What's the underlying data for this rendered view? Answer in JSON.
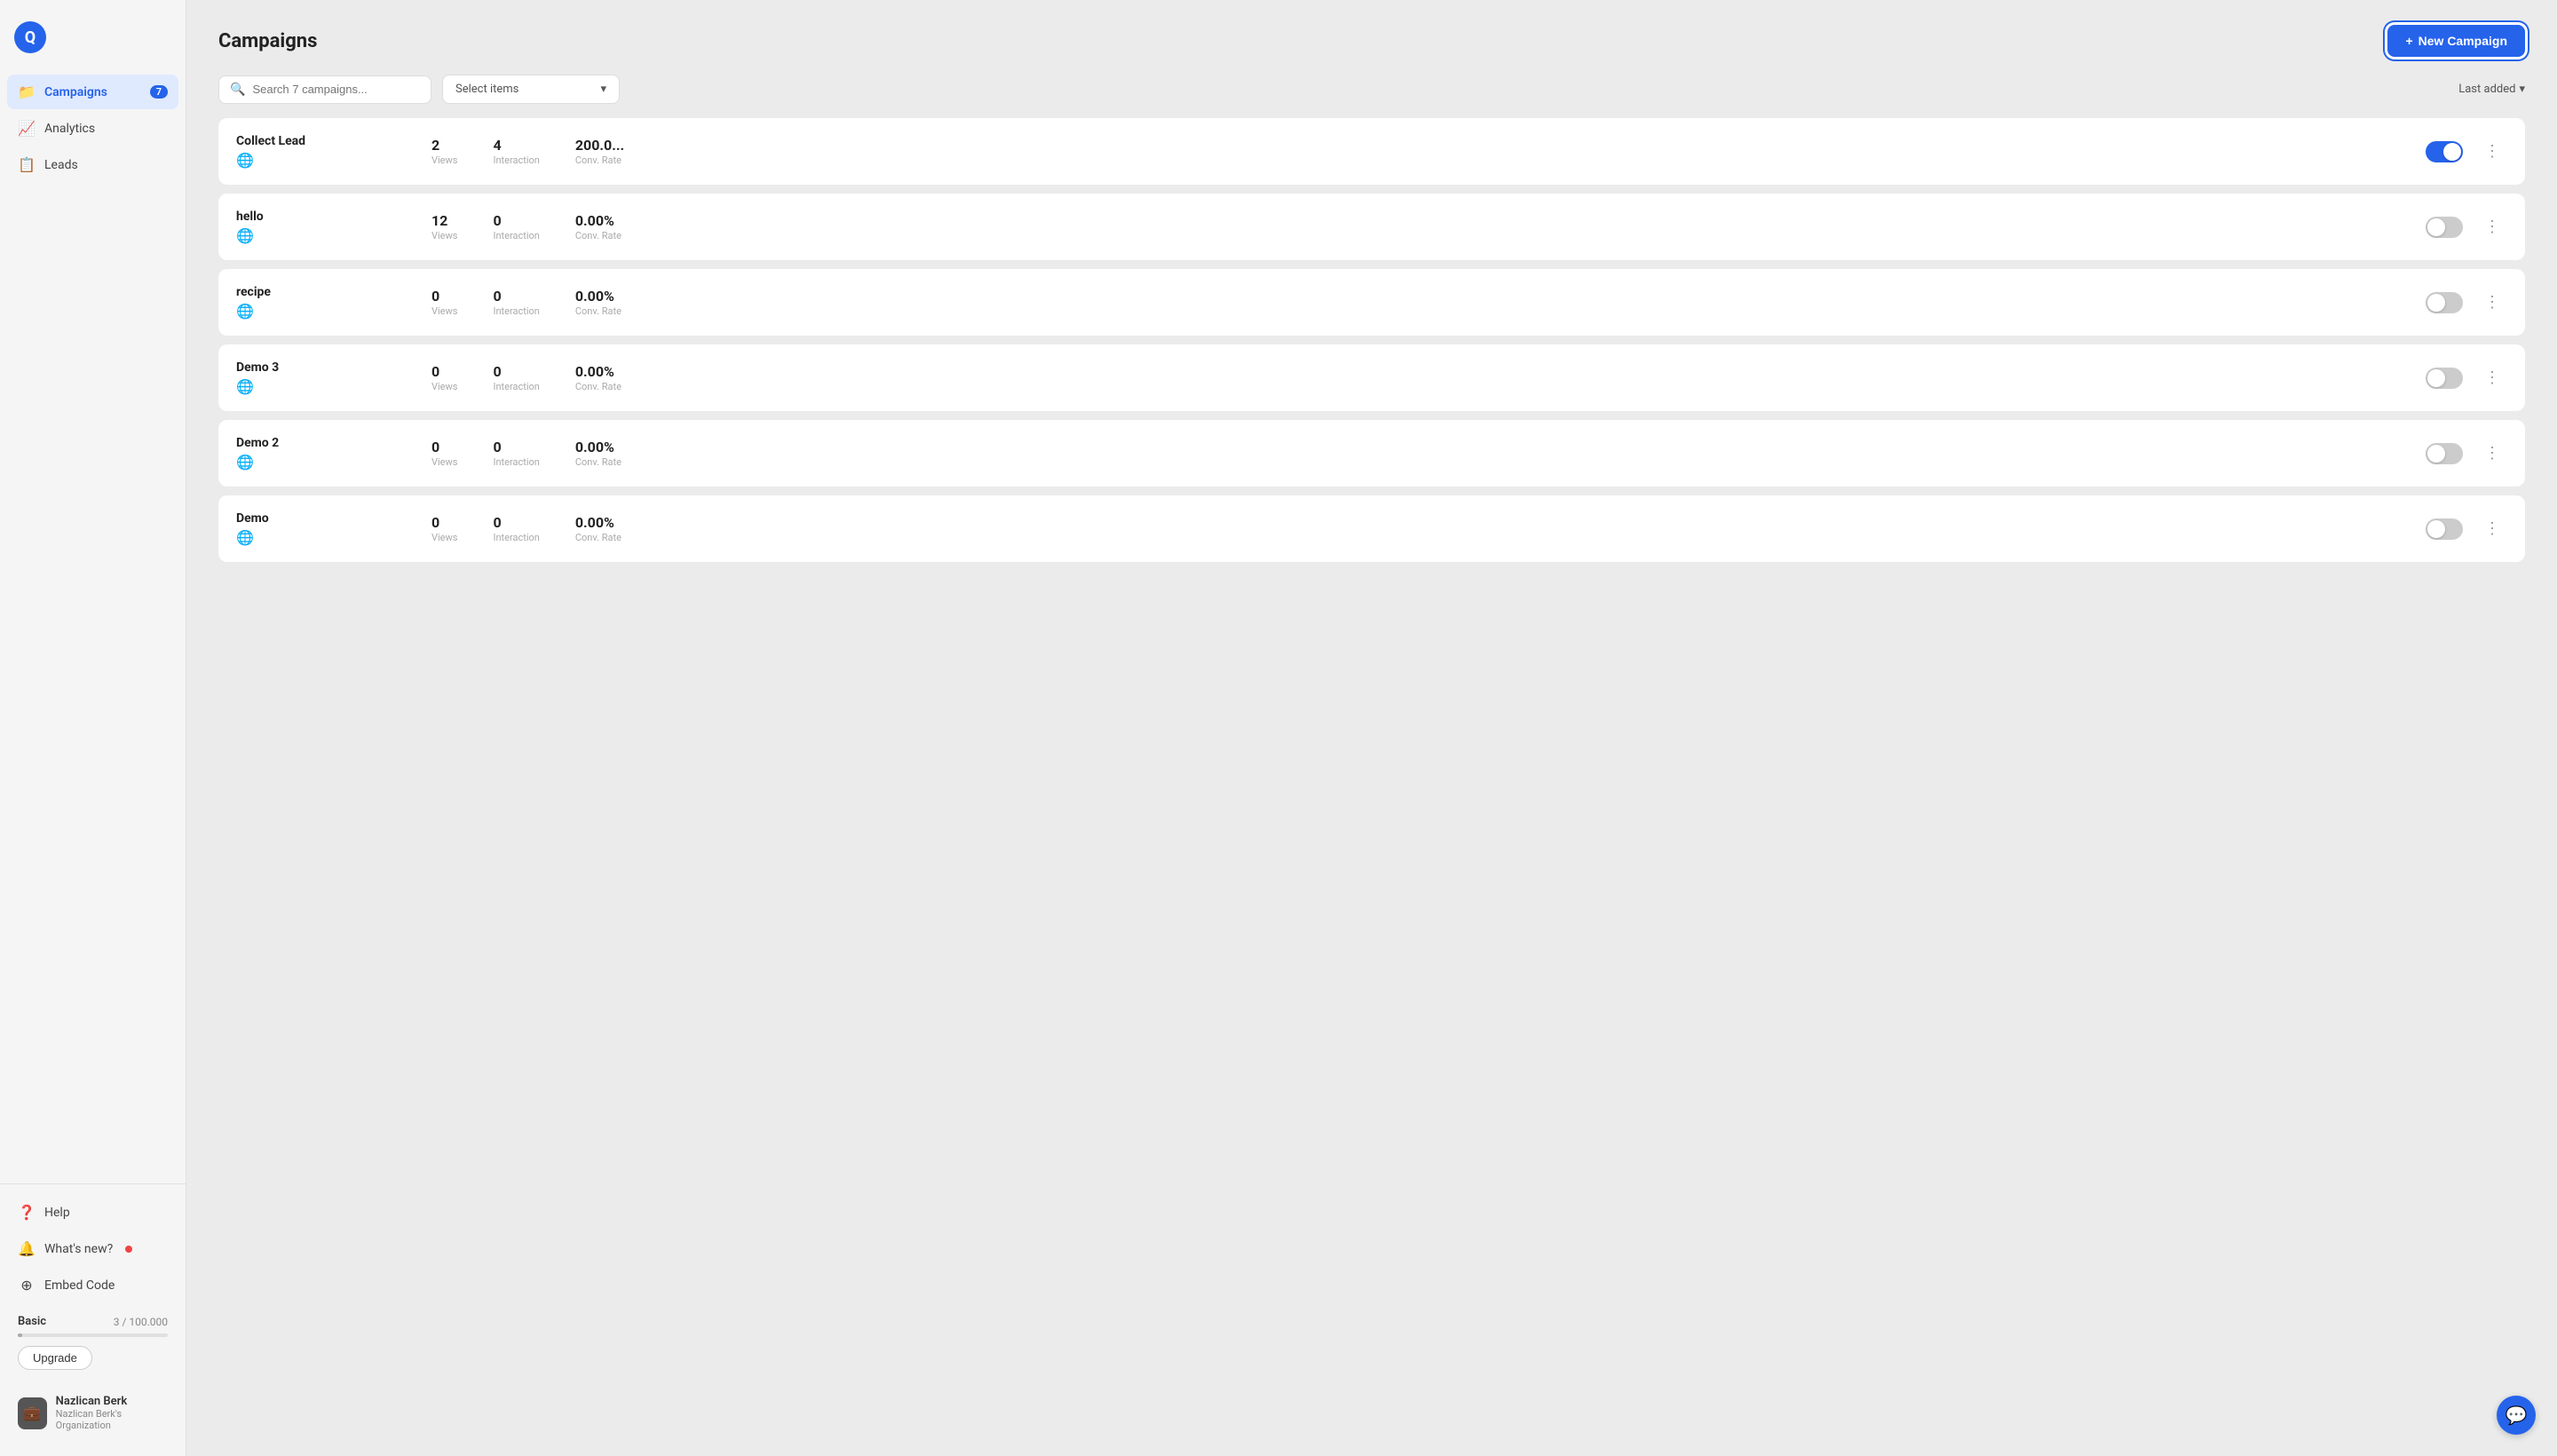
{
  "sidebar": {
    "logo_text": "Q",
    "nav_items": [
      {
        "id": "campaigns",
        "label": "Campaigns",
        "icon": "📁",
        "badge": "7",
        "active": true
      },
      {
        "id": "analytics",
        "label": "Analytics",
        "icon": "📈",
        "badge": null,
        "active": false
      },
      {
        "id": "leads",
        "label": "Leads",
        "icon": "📋",
        "badge": null,
        "active": false
      }
    ],
    "bottom_items": [
      {
        "id": "help",
        "label": "Help",
        "icon": "❓",
        "dot": false
      },
      {
        "id": "whats-new",
        "label": "What's new?",
        "icon": "🔔",
        "dot": true
      },
      {
        "id": "embed-code",
        "label": "Embed Code",
        "icon": "⊕",
        "dot": false
      }
    ],
    "plan": {
      "name": "Basic",
      "usage": "3 / 100.000",
      "bar_pct": 3,
      "upgrade_label": "Upgrade"
    },
    "user": {
      "name": "Nazlican Berk",
      "org": "Nazlican Berk's Organization",
      "avatar_icon": "💼"
    }
  },
  "header": {
    "title": "Campaigns",
    "new_button_label": "New Campaign",
    "new_button_icon": "+"
  },
  "toolbar": {
    "search_placeholder": "Search 7 campaigns...",
    "select_placeholder": "Select items",
    "sort_label": "Last added",
    "sort_icon": "▾"
  },
  "campaigns": [
    {
      "name": "Collect Lead",
      "views": "2",
      "interaction": "4",
      "conv_rate": "200.0...",
      "enabled": true
    },
    {
      "name": "hello",
      "views": "12",
      "interaction": "0",
      "conv_rate": "0.00%",
      "enabled": false
    },
    {
      "name": "recipe",
      "views": "0",
      "interaction": "0",
      "conv_rate": "0.00%",
      "enabled": null
    },
    {
      "name": "Demo 3",
      "views": "0",
      "interaction": "0",
      "conv_rate": "0.00%",
      "enabled": false
    },
    {
      "name": "Demo 2",
      "views": "0",
      "interaction": "0",
      "conv_rate": "0.00%",
      "enabled": false
    },
    {
      "name": "Demo",
      "views": "0",
      "interaction": "0",
      "conv_rate": "0.00%",
      "enabled": false
    }
  ],
  "labels": {
    "views": "Views",
    "interaction": "Interaction",
    "conv_rate": "Conv. Rate"
  }
}
